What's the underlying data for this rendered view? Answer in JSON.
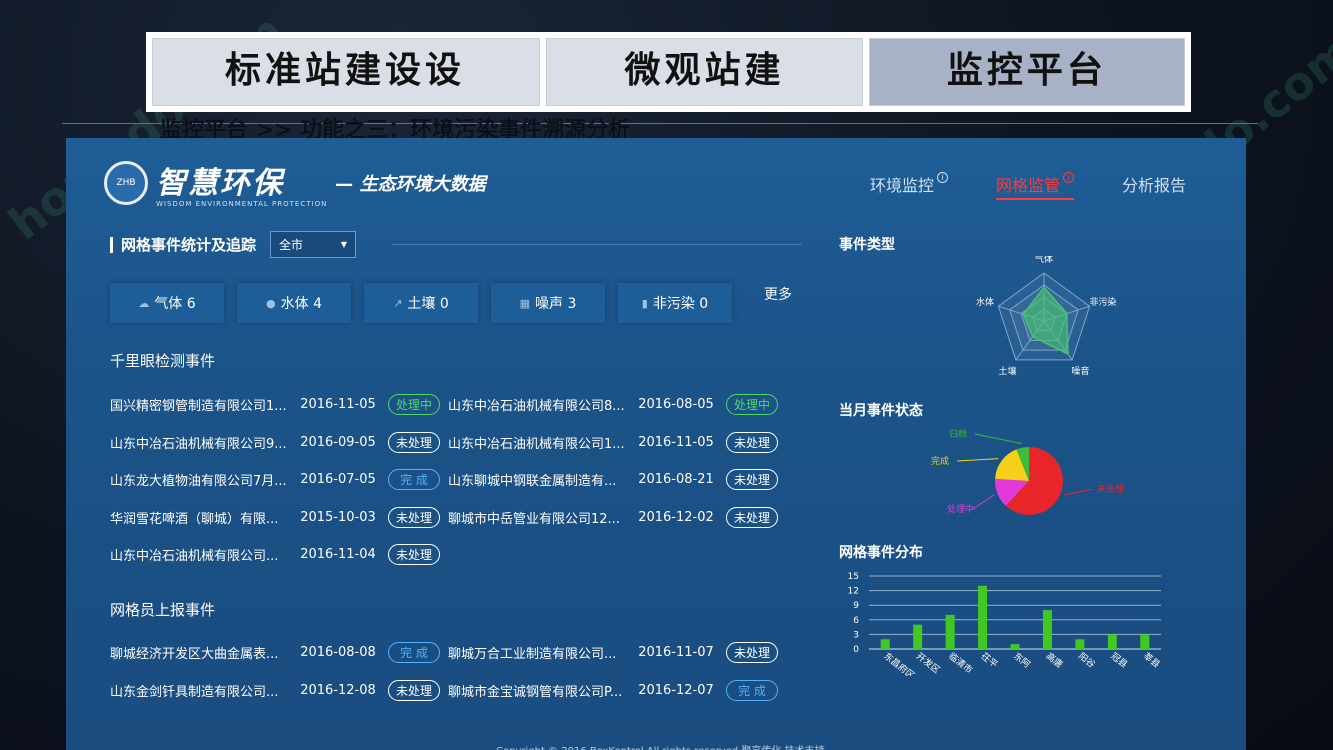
{
  "tabs": [
    {
      "label": "标准站建设设",
      "active": false
    },
    {
      "label": "微观站建",
      "active": false
    },
    {
      "label": "监控平台",
      "active": true
    }
  ],
  "subtitle": "监控平台 >> 功能之三：环境污染事件溯源分析",
  "dashboard": {
    "logo": {
      "title": "智慧环保",
      "sub": "WISDOM ENVIRONMENTAL PROTECTION",
      "slogan": "— 生态环境大数据",
      "emblem": "ZHB"
    },
    "nav": [
      {
        "label": "环境监控",
        "active": false
      },
      {
        "label": "网格监管",
        "active": true
      },
      {
        "label": "分析报告",
        "active": false
      }
    ],
    "section_title": "网格事件统计及追踪",
    "filter": {
      "value": "全市"
    },
    "categories": [
      {
        "label": "气体 6",
        "icon": "cloud-icon"
      },
      {
        "label": "水体 4",
        "icon": "drop-icon"
      },
      {
        "label": "土壤 0",
        "icon": "shovel-icon"
      },
      {
        "label": "噪声 3",
        "icon": "grid-icon"
      },
      {
        "label": "非污染 0",
        "icon": "trash-icon"
      }
    ],
    "more": "更多",
    "qianliyan": {
      "title": "千里眼检测事件",
      "rows": [
        [
          {
            "name": "国兴精密钢管制造有限公司1...",
            "date": "2016-11-05",
            "status": "处理中"
          },
          {
            "name": "山东中冶石油机械有限公司8...",
            "date": "2016-08-05",
            "status": "处理中"
          }
        ],
        [
          {
            "name": "山东中冶石油机械有限公司9...",
            "date": "2016-09-05",
            "status": "未处理"
          },
          {
            "name": "山东中冶石油机械有限公司1...",
            "date": "2016-11-05",
            "status": "未处理"
          }
        ],
        [
          {
            "name": "山东龙大植物油有限公司7月...",
            "date": "2016-07-05",
            "status": "完 成"
          },
          {
            "name": "山东聊城中钢联金属制造有...",
            "date": "2016-08-21",
            "status": "未处理"
          }
        ],
        [
          {
            "name": "华润雪花啤酒（聊城）有限...",
            "date": "2015-10-03",
            "status": "未处理"
          },
          {
            "name": "聊城市中岳管业有限公司12...",
            "date": "2016-12-02",
            "status": "未处理"
          }
        ],
        [
          {
            "name": "山东中冶石油机械有限公司...",
            "date": "2016-11-04",
            "status": "未处理"
          }
        ]
      ]
    },
    "wanggeyuan": {
      "title": "网格员上报事件",
      "rows": [
        [
          {
            "name": "聊城经济开发区大曲金属表...",
            "date": "2016-08-08",
            "status": "完 成"
          },
          {
            "name": "聊城万合工业制造有限公司...",
            "date": "2016-11-07",
            "status": "未处理"
          }
        ],
        [
          {
            "name": "山东金剑钎具制造有限公司...",
            "date": "2016-12-08",
            "status": "未处理"
          },
          {
            "name": "聊城市金宝诚钢管有限公司P...",
            "date": "2016-12-07",
            "status": "完 成"
          }
        ]
      ]
    },
    "status_colors": {
      "处理中": "#4cd964",
      "未处理": "#ffffff",
      "完 成": "#4fb3ff"
    },
    "event_type": {
      "title": "事件类型",
      "axes": [
        "气体",
        "非污染",
        "噪音",
        "土壤",
        "水体"
      ]
    },
    "month_status": {
      "title": "当月事件状态",
      "labels": [
        "归档",
        "完成",
        "处理中",
        "未处理"
      ]
    },
    "grid_dist": {
      "title": "网格事件分布"
    },
    "copyright": "Copyright © 2016 BoxKontrol All rights reserved 聚亨传化 技术支持"
  },
  "chart_data": [
    {
      "type": "radar",
      "title": "事件类型",
      "categories": [
        "气体",
        "非污染",
        "噪音",
        "土壤",
        "水体"
      ],
      "values": [
        0.7,
        0.5,
        0.85,
        0.4,
        0.45
      ],
      "max": 1,
      "color": "#45c46b"
    },
    {
      "type": "pie",
      "title": "当月事件状态",
      "categories": [
        "未处理",
        "处理中",
        "完成",
        "归档"
      ],
      "values": [
        62,
        14,
        18,
        6
      ],
      "colors": [
        "#e8252b",
        "#e23ad9",
        "#f5d018",
        "#3dbb3a"
      ]
    },
    {
      "type": "bar",
      "title": "网格事件分布",
      "categories": [
        "东昌府区",
        "开发区",
        "临清市",
        "茌平",
        "东阿",
        "高唐",
        "阳谷",
        "冠县",
        "莘县"
      ],
      "values": [
        2,
        5,
        7,
        13,
        1,
        8,
        2,
        3,
        3
      ],
      "ylim": [
        0,
        15
      ],
      "yticks": [
        0,
        3,
        6,
        9,
        12,
        15
      ],
      "color": "#43c822"
    }
  ]
}
